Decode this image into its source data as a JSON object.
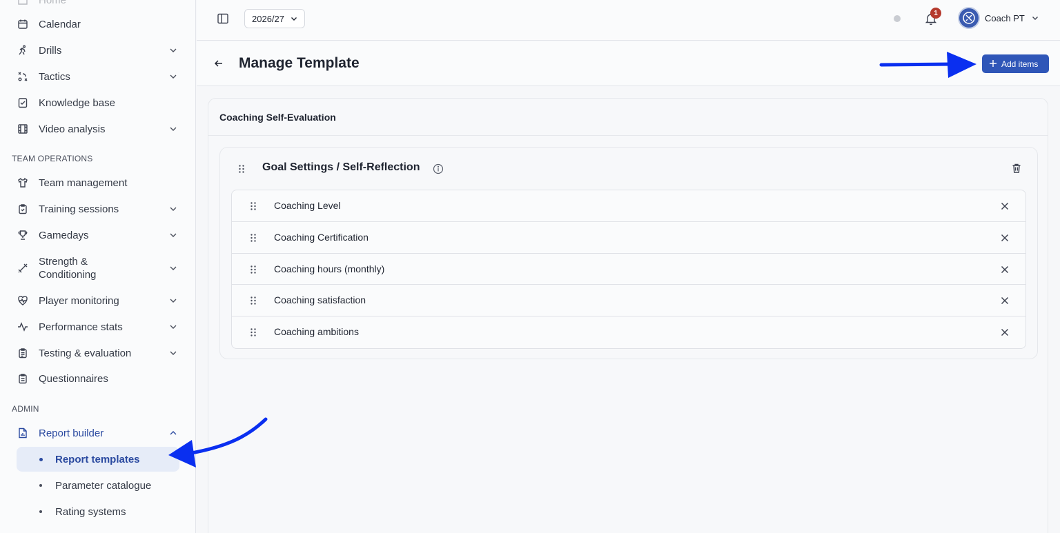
{
  "sidebar": {
    "top_partial_label": "Home",
    "items": [
      {
        "label": "Calendar",
        "icon": "calendar-icon"
      },
      {
        "label": "Drills",
        "icon": "runner-icon"
      },
      {
        "label": "Tactics",
        "icon": "tactics-icon"
      },
      {
        "label": "Knowledge base",
        "icon": "checklist-icon"
      },
      {
        "label": "Video analysis",
        "icon": "film-icon"
      }
    ],
    "team_ops_label": "TEAM OPERATIONS",
    "team_items": [
      {
        "label": "Team management",
        "icon": "jersey-icon"
      },
      {
        "label": "Training sessions",
        "icon": "clipboard-icon"
      },
      {
        "label": "Gamedays",
        "icon": "trophy-icon"
      },
      {
        "label": "Strength & Conditioning",
        "icon": "dumbbell-icon"
      },
      {
        "label": "Player monitoring",
        "icon": "heart-pulse-icon"
      },
      {
        "label": "Performance stats",
        "icon": "activity-icon"
      },
      {
        "label": "Testing & evaluation",
        "icon": "clipboard-list-icon"
      },
      {
        "label": "Questionnaires",
        "icon": "clipboard-text-icon"
      }
    ],
    "admin_label": "ADMIN",
    "report_builder_label": "Report builder",
    "report_sub": [
      {
        "label": "Report templates",
        "active": true
      },
      {
        "label": "Parameter catalogue",
        "active": false
      },
      {
        "label": "Rating systems",
        "active": false
      }
    ]
  },
  "topbar": {
    "season": "2026/27",
    "notification_count": "1",
    "user_name": "Coach PT"
  },
  "header": {
    "title": "Manage Template",
    "add_items_label": "Add items"
  },
  "template": {
    "name": "Coaching Self-Evaluation",
    "group_title": "Goal Settings / Self-Reflection",
    "items": [
      "Coaching Level",
      "Coaching Certification",
      "Coaching hours (monthly)",
      "Coaching satisfaction",
      "Coaching ambitions"
    ]
  },
  "colors": {
    "accent": "#2f56b8",
    "active_nav_bg": "#e6ecf8",
    "badge": "#b53a2e",
    "annotation_arrow": "#0a2ff0"
  }
}
